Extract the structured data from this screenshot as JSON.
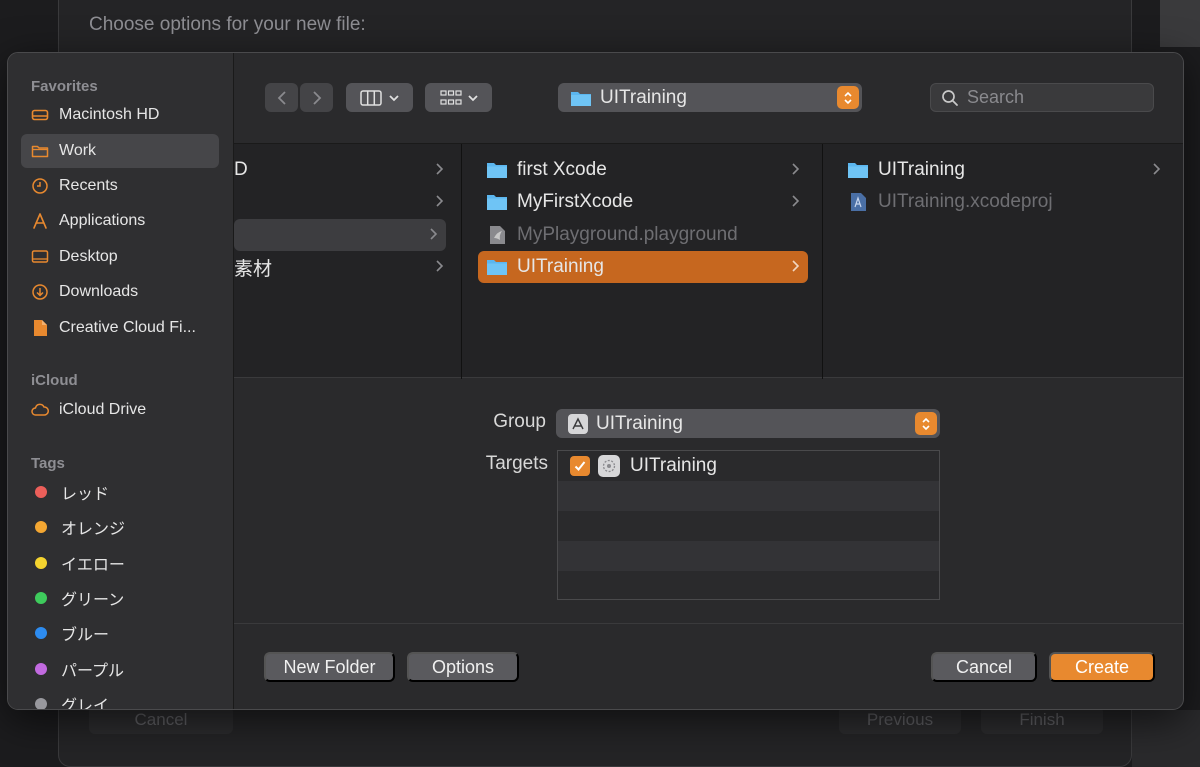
{
  "background_sheet": {
    "title": "Choose options for your new file:",
    "cancel_label": "Cancel",
    "previous_label": "Previous",
    "finish_label": "Finish"
  },
  "sidebar": {
    "favorites_header": "Favorites",
    "favorites": [
      {
        "label": "Macintosh HD",
        "icon": "drive-icon"
      },
      {
        "label": "Work",
        "icon": "folder-icon",
        "selected": true
      },
      {
        "label": "Recents",
        "icon": "clock-icon"
      },
      {
        "label": "Applications",
        "icon": "applications-icon"
      },
      {
        "label": "Desktop",
        "icon": "desktop-icon"
      },
      {
        "label": "Downloads",
        "icon": "download-icon"
      },
      {
        "label": "Creative Cloud Fi...",
        "icon": "document-icon"
      }
    ],
    "icloud_header": "iCloud",
    "icloud": [
      {
        "label": "iCloud Drive",
        "icon": "cloud-icon"
      }
    ],
    "tags_header": "Tags",
    "tags": [
      {
        "label": "レッド",
        "color": "#ec5f5a"
      },
      {
        "label": "オレンジ",
        "color": "#f4a732"
      },
      {
        "label": "イエロー",
        "color": "#f5d42f"
      },
      {
        "label": "グリーン",
        "color": "#3ecb5c"
      },
      {
        "label": "ブルー",
        "color": "#2d8cf0"
      },
      {
        "label": "パープル",
        "color": "#c26ae0"
      },
      {
        "label": "グレイ",
        "color": "#98989d"
      }
    ]
  },
  "toolbar": {
    "path_label": "UITraining",
    "search_placeholder": "Search"
  },
  "browser": {
    "column1": [
      {
        "label": "D",
        "has_children": true
      },
      {
        "label": "",
        "has_children": true
      },
      {
        "label": "",
        "has_children": true,
        "selected": true
      },
      {
        "label": "素材",
        "has_children": true
      }
    ],
    "column2": [
      {
        "label": "first Xcode",
        "type": "folder",
        "has_children": true
      },
      {
        "label": "MyFirstXcode",
        "type": "folder",
        "has_children": true
      },
      {
        "label": "MyPlayground.playground",
        "type": "playground",
        "dimmed": true
      },
      {
        "label": "UITraining",
        "type": "folder",
        "has_children": true,
        "selected": true
      }
    ],
    "column3": [
      {
        "label": "UITraining",
        "type": "folder",
        "has_children": true
      },
      {
        "label": "UITraining.xcodeproj",
        "type": "xcodeproj",
        "dimmed": true
      }
    ]
  },
  "options": {
    "group_label": "Group",
    "group_value": "UITraining",
    "targets_label": "Targets",
    "targets": [
      {
        "label": "UITraining",
        "checked": true
      }
    ]
  },
  "footer": {
    "new_folder_label": "New Folder",
    "options_label": "Options",
    "cancel_label": "Cancel",
    "create_label": "Create"
  },
  "colors": {
    "accent": "#e8892f",
    "selection": "#c6671f"
  }
}
